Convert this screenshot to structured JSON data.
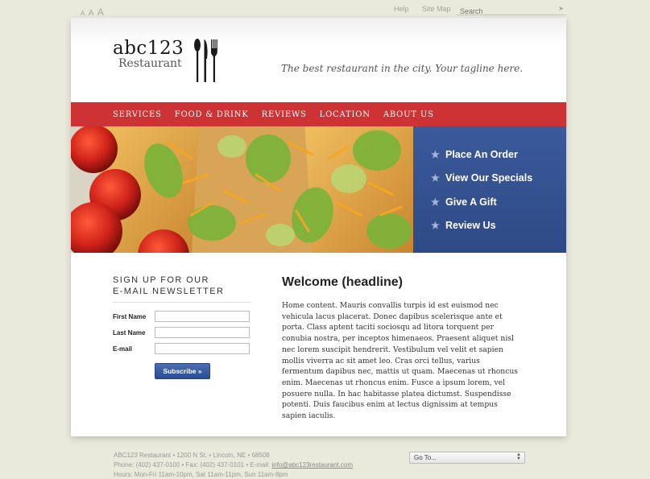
{
  "top_bar": {
    "text_size": [
      "A",
      "A",
      "A"
    ],
    "links": [
      "Help",
      "Site Map"
    ],
    "search_placeholder": "Search"
  },
  "header": {
    "logo_name": "abc123",
    "logo_sub": "Restaurant",
    "tagline": "The best restaurant in the city. Your tagline here."
  },
  "nav": [
    "Services",
    "Food & Drink",
    "Reviews",
    "Location",
    "About Us"
  ],
  "side_menu": [
    "Place An Order",
    "View Our Specials",
    "Give A Gift",
    "Review Us"
  ],
  "newsletter": {
    "title_line1": "Sign up for our",
    "title_line2": "e-mail newsletter",
    "fields": [
      "First Name",
      "Last Name",
      "E-mail"
    ],
    "button": "Subscribe »"
  },
  "content": {
    "headline": "Welcome (headline)",
    "body": "Home content. Mauris convallis turpis id est euismod nec vehicula lacus placerat. Donec dapibus scelerisque ante et porta. Class aptent taciti sociosqu ad litora torquent per conubia nostra, per inceptos himenaeos. Praesent aliquet nisl nec lorem suscipit hendrerit. Vestibulum vel velit et sapien mollis viverra ac sit amet leo. Cras orci tellus, varius fermentum dapibus nec, mattis ut quam. Maecenas ut rhoncus enim. Maecenas ut rhoncus enim. Fusce a ipsum lorem, vel posuere nulla. In hac habitasse platea dictumst. Suspendisse potenti. Duis faucibus enim at lectus dignissim at tempus sapien iaculis."
  },
  "footer": {
    "line1": "ABC123 Restaurant • 1200 N St. • Lincoln, NE • 68508",
    "line2_prefix": "Phone: (402) 437-0100 • Fax: (402) 437-0101 • E-mail: ",
    "email": "info@abc123restaurant.com",
    "line3": "Hours: Mon-Fri 11am-10pm, Sat 11am-11pm, Sun 11am-8pm",
    "goto": "Go To..."
  },
  "colors": {
    "nav_red": "#cd3234",
    "menu_blue": "#3b5a9b",
    "background": "#e9e9dc"
  },
  "icons": [
    "star-icon",
    "fork-spoon-knife-icon",
    "search-go-icon",
    "select-arrows-icon"
  ]
}
